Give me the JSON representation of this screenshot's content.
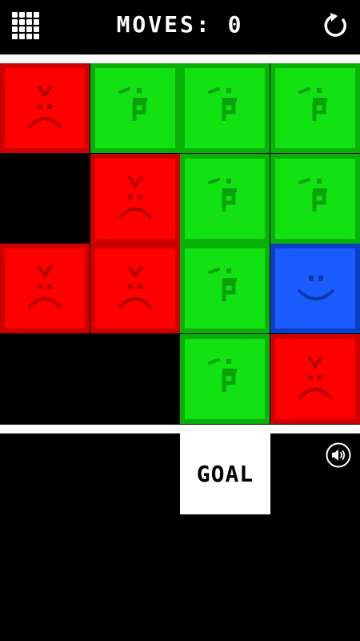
{
  "header": {
    "moves_label": "MOVES: 0",
    "menu_icon": "grid-menu-icon",
    "restart_icon": "restart-icon"
  },
  "goal": {
    "label": "GOAL"
  },
  "footer": {
    "sound_icon": "sound-on-icon"
  },
  "colors": {
    "red": "#ff0000",
    "red_border": "#cc0000",
    "red_face": "#b30000",
    "green": "#12e212",
    "green_border": "#08b008",
    "green_face": "#0aa20a",
    "blue": "#1a5cff",
    "blue_border": "#0b3fc4",
    "blue_face": "#0b3aa8",
    "background": "#000000",
    "rail": "#ffffff"
  },
  "board": {
    "columns": 4,
    "rows": 4,
    "cells": [
      [
        "red-sad",
        "green-tongue",
        "green-tongue",
        "green-tongue"
      ],
      [
        "empty",
        "red-sad",
        "green-tongue",
        "green-tongue"
      ],
      [
        "red-sad",
        "red-sad",
        "green-tongue",
        "blue-smile"
      ],
      [
        "empty",
        "empty",
        "green-tongue",
        "red-sad"
      ]
    ]
  }
}
